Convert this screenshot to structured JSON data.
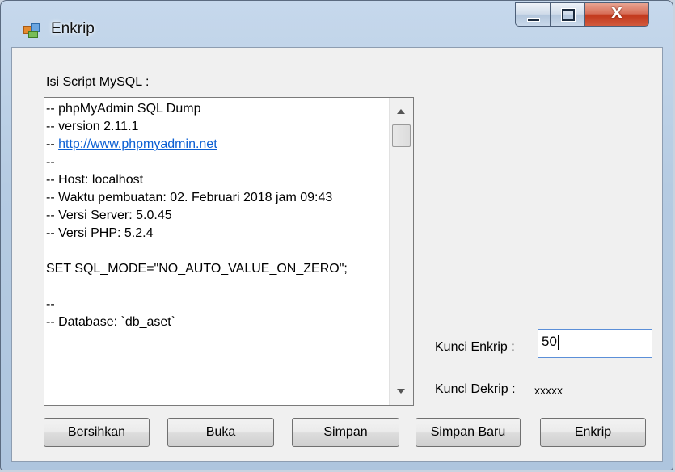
{
  "window": {
    "title": "Enkrip",
    "close_label": "X"
  },
  "form": {
    "script_label": "Isi Script MySQL :",
    "script_lines": [
      "-- phpMyAdmin SQL Dump",
      "-- version 2.11.1",
      "-- ",
      "--",
      "-- Host: localhost",
      "-- Waktu pembuatan: 02. Februari 2018 jam 09:43",
      "-- Versi Server: 5.0.45",
      "-- Versi PHP: 5.2.4",
      "",
      "SET SQL_MODE=\"NO_AUTO_VALUE_ON_ZERO\";",
      "",
      "--",
      "-- Database: `db_aset`"
    ],
    "script_link": "http://www.phpmyadmin.net",
    "kunci_enkrip_label": "Kunci Enkrip :",
    "kunci_enkrip_value": "50",
    "kunci_dekrip_label": "Kuncl Dekrip :",
    "kunci_dekrip_value": "xxxxx"
  },
  "buttons": {
    "clear": "Bersihkan",
    "open": "Buka",
    "save": "Simpan",
    "save_new": "Simpan Baru",
    "encrypt": "Enkrip"
  }
}
